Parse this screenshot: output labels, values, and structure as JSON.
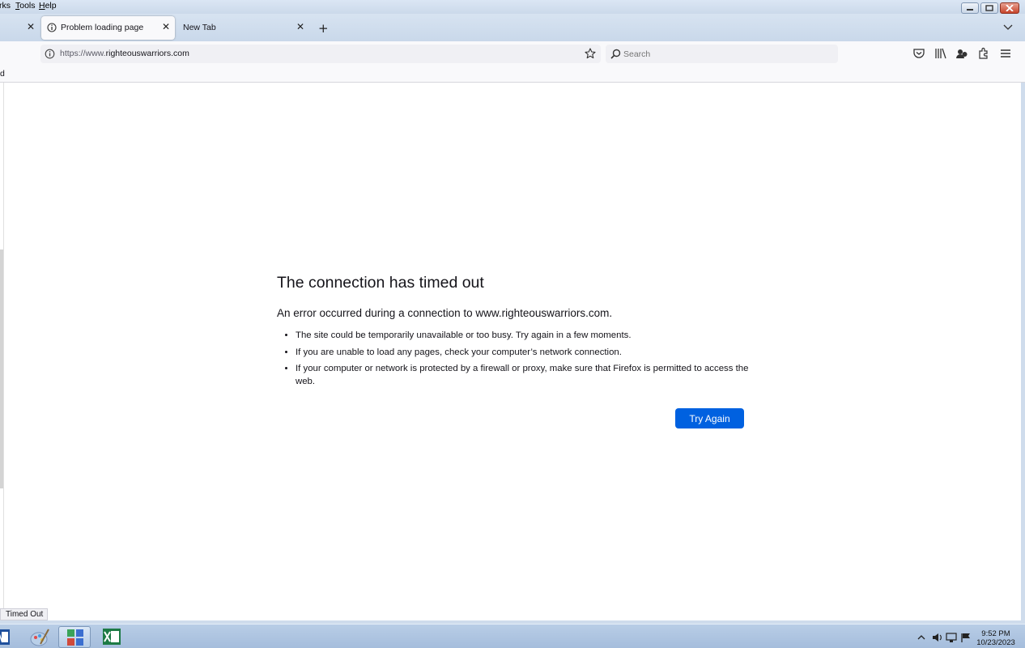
{
  "menubar": {
    "items": [
      {
        "label": "rks",
        "access": ""
      },
      {
        "label": "Tools",
        "access": "T"
      },
      {
        "label": "Help",
        "access": "H"
      }
    ]
  },
  "tabs": [
    {
      "label": "",
      "active": false
    },
    {
      "label": "Problem loading page",
      "active": true
    },
    {
      "label": "New Tab",
      "active": false
    }
  ],
  "navbar": {
    "url_prefix": "https://www.",
    "url_domain": "righteouswarriors.com",
    "search_placeholder": "Search"
  },
  "bookmarks_fragment": "d",
  "error": {
    "title": "The connection has timed out",
    "short_desc": "An error occurred during a connection to www.righteouswarriors.com.",
    "bullets": [
      "The site could be temporarily unavailable or too busy. Try again in a few moments.",
      "If you are unable to load any pages, check your computer’s network connection.",
      "If your computer or network is protected by a firewall or proxy, make sure that Firefox is permitted to access the web."
    ],
    "button_label": "Try Again"
  },
  "status_text": "Timed Out",
  "taskbar": {
    "time": "9:52 PM",
    "date": "10/23/2023"
  },
  "colors": {
    "accent": "#0061e0",
    "window_frame": "#cfdcec",
    "page_bg": "#ffffff"
  },
  "icons": [
    "info-icon",
    "close-icon",
    "new-tab-icon",
    "list-all-tabs-icon",
    "bookmark-star-icon",
    "search-icon",
    "pocket-icon",
    "library-icon",
    "account-icon",
    "extensions-icon",
    "menu-icon",
    "word-icon",
    "paint-icon",
    "control-panel-icon",
    "excel-icon"
  ]
}
